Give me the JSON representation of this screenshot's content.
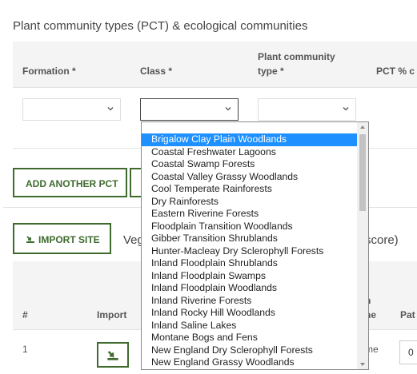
{
  "section_title": "Plant community types (PCT) & ecological communities",
  "columns": {
    "formation": "Formation *",
    "class": "Class *",
    "pct_line1": "Plant community",
    "pct_line2": "type *",
    "pct_percent": "PCT % c"
  },
  "selects": {
    "formation_value": "",
    "class_value": "",
    "pct_value": ""
  },
  "buttons": {
    "add_pct": "ADD ANOTHER PCT",
    "import_site": "IMPORT SITE"
  },
  "veg_text": "Veg",
  "score_text": "score)",
  "table2": {
    "col_hash": "#",
    "col_import": "Import",
    "col_partial_line1": "n",
    "col_partial_line2": "ne",
    "col_pat": "Pat",
    "row1_num": "1",
    "row1_partial": "me",
    "row1_input": "0"
  },
  "dropdown_options": [
    "Brigalow Clay Plain Woodlands",
    "Coastal Freshwater Lagoons",
    "Coastal Swamp Forests",
    "Coastal Valley Grassy Woodlands",
    "Cool Temperate Rainforests",
    "Dry Rainforests",
    "Eastern Riverine Forests",
    "Floodplain Transition Woodlands",
    "Gibber Transition Shrublands",
    "Hunter-Macleay Dry Sclerophyll Forests",
    "Inland Floodplain Shrublands",
    "Inland Floodplain Swamps",
    "Inland Floodplain Woodlands",
    "Inland Riverine Forests",
    "Inland Rocky Hill Woodlands",
    "Inland Saline Lakes",
    "Montane Bogs and Fens",
    "New England Dry Sclerophyll Forests",
    "New England Grassy Woodlands"
  ],
  "dropdown_selected_index": 0,
  "colors": {
    "accent_green": "#3e6b2d",
    "selection_blue": "#1e90ff"
  }
}
